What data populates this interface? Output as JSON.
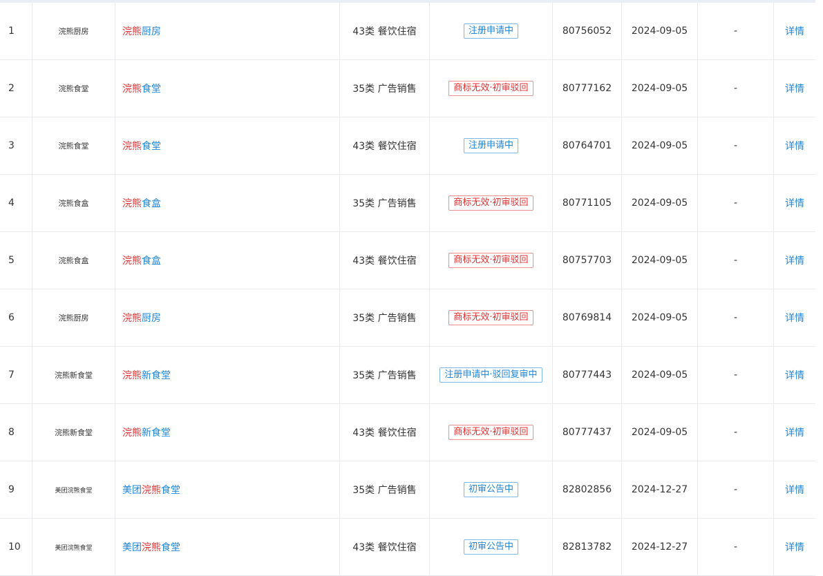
{
  "rows": [
    {
      "index": "1",
      "logo": "浣熊厨房",
      "logo_small": false,
      "name_pre": "",
      "name_hl": "浣熊",
      "name_post": "厨房",
      "class_label": "43类 餐饮住宿",
      "status": "注册申请中",
      "status_color": "#1e86d8",
      "reg_no": "80756052",
      "date": "2024-09-05",
      "dash": "-",
      "detail": "详情"
    },
    {
      "index": "2",
      "logo": "浣熊食堂",
      "logo_small": false,
      "name_pre": "",
      "name_hl": "浣熊",
      "name_post": "食堂",
      "class_label": "35类 广告销售",
      "status": "商标无效·初审驳回",
      "status_color": "#e03232",
      "reg_no": "80777162",
      "date": "2024-09-05",
      "dash": "-",
      "detail": "详情"
    },
    {
      "index": "3",
      "logo": "浣熊食堂",
      "logo_small": false,
      "name_pre": "",
      "name_hl": "浣熊",
      "name_post": "食堂",
      "class_label": "43类 餐饮住宿",
      "status": "注册申请中",
      "status_color": "#1e86d8",
      "reg_no": "80764701",
      "date": "2024-09-05",
      "dash": "-",
      "detail": "详情"
    },
    {
      "index": "4",
      "logo": "浣熊食盒",
      "logo_small": false,
      "name_pre": "",
      "name_hl": "浣熊",
      "name_post": "食盒",
      "class_label": "35类 广告销售",
      "status": "商标无效·初审驳回",
      "status_color": "#e03232",
      "reg_no": "80771105",
      "date": "2024-09-05",
      "dash": "-",
      "detail": "详情"
    },
    {
      "index": "5",
      "logo": "浣熊食盒",
      "logo_small": false,
      "name_pre": "",
      "name_hl": "浣熊",
      "name_post": "食盒",
      "class_label": "43类 餐饮住宿",
      "status": "商标无效·初审驳回",
      "status_color": "#e03232",
      "reg_no": "80757703",
      "date": "2024-09-05",
      "dash": "-",
      "detail": "详情"
    },
    {
      "index": "6",
      "logo": "浣熊厨房",
      "logo_small": false,
      "name_pre": "",
      "name_hl": "浣熊",
      "name_post": "厨房",
      "class_label": "35类 广告销售",
      "status": "商标无效·初审驳回",
      "status_color": "#e03232",
      "reg_no": "80769814",
      "date": "2024-09-05",
      "dash": "-",
      "detail": "详情"
    },
    {
      "index": "7",
      "logo": "浣熊新食堂",
      "logo_small": false,
      "name_pre": "",
      "name_hl": "浣熊",
      "name_post": "新食堂",
      "class_label": "35类 广告销售",
      "status": "注册申请中·驳回复审中",
      "status_color": "#1e86d8",
      "reg_no": "80777443",
      "date": "2024-09-05",
      "dash": "-",
      "detail": "详情"
    },
    {
      "index": "8",
      "logo": "浣熊新食堂",
      "logo_small": false,
      "name_pre": "",
      "name_hl": "浣熊",
      "name_post": "新食堂",
      "class_label": "43类 餐饮住宿",
      "status": "商标无效·初审驳回",
      "status_color": "#e03232",
      "reg_no": "80777437",
      "date": "2024-09-05",
      "dash": "-",
      "detail": "详情"
    },
    {
      "index": "9",
      "logo": "美团浣熊食堂",
      "logo_small": true,
      "name_pre": "美团",
      "name_hl": "浣熊",
      "name_post": "食堂",
      "class_label": "35类 广告销售",
      "status": "初审公告中",
      "status_color": "#1e86d8",
      "reg_no": "82802856",
      "date": "2024-12-27",
      "dash": "-",
      "detail": "详情"
    },
    {
      "index": "10",
      "logo": "美团浣熊食堂",
      "logo_small": true,
      "name_pre": "美团",
      "name_hl": "浣熊",
      "name_post": "食堂",
      "class_label": "43类 餐饮住宿",
      "status": "初审公告中",
      "status_color": "#1e86d8",
      "reg_no": "82813782",
      "date": "2024-12-27",
      "dash": "-",
      "detail": "详情"
    }
  ]
}
